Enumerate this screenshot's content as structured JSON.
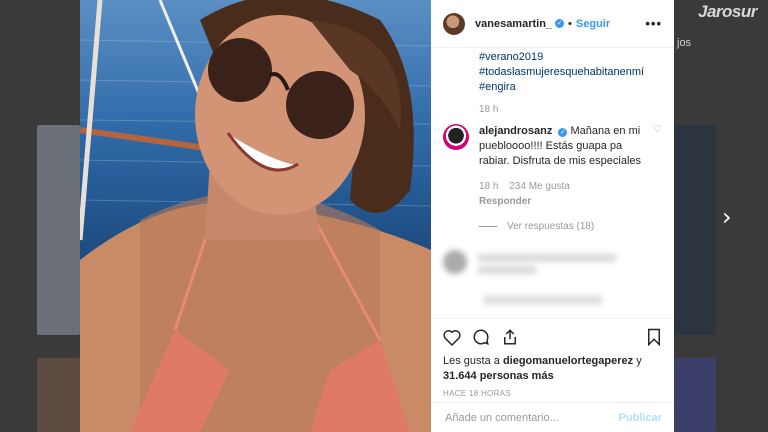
{
  "post": {
    "username": "vanesamartin_",
    "follow_label": "Seguir",
    "more_label": "•••",
    "caption_hashtags": [
      "#verano2019",
      "#todaslasmujeresquehabitanenmí",
      "#engira"
    ],
    "caption_time": "18 h",
    "comment": {
      "username": "alejandrosanz",
      "text": "Mañana en mi puebloooo!!!! Estás guapa pa rabiar. Disfruta de mis especiales",
      "time": "18 h",
      "likes": "234 Me gusta",
      "reply_label": "Responder",
      "view_replies": "Ver respuestas (18)"
    },
    "likes_prefix": "Les gusta a ",
    "likes_user": "diegomanuelortegaperez",
    "likes_conj": " y",
    "likes_count": "31.644 personas más",
    "timestamp": "HACE 18 HORAS",
    "comment_placeholder": "Añade un comentario...",
    "publish_label": "Publicar"
  },
  "background": {
    "side_text": "jos",
    "watermark": "Jarosur"
  },
  "colors": {
    "link_blue": "#3897f0",
    "hashtag": "#003569",
    "muted": "#999999"
  }
}
